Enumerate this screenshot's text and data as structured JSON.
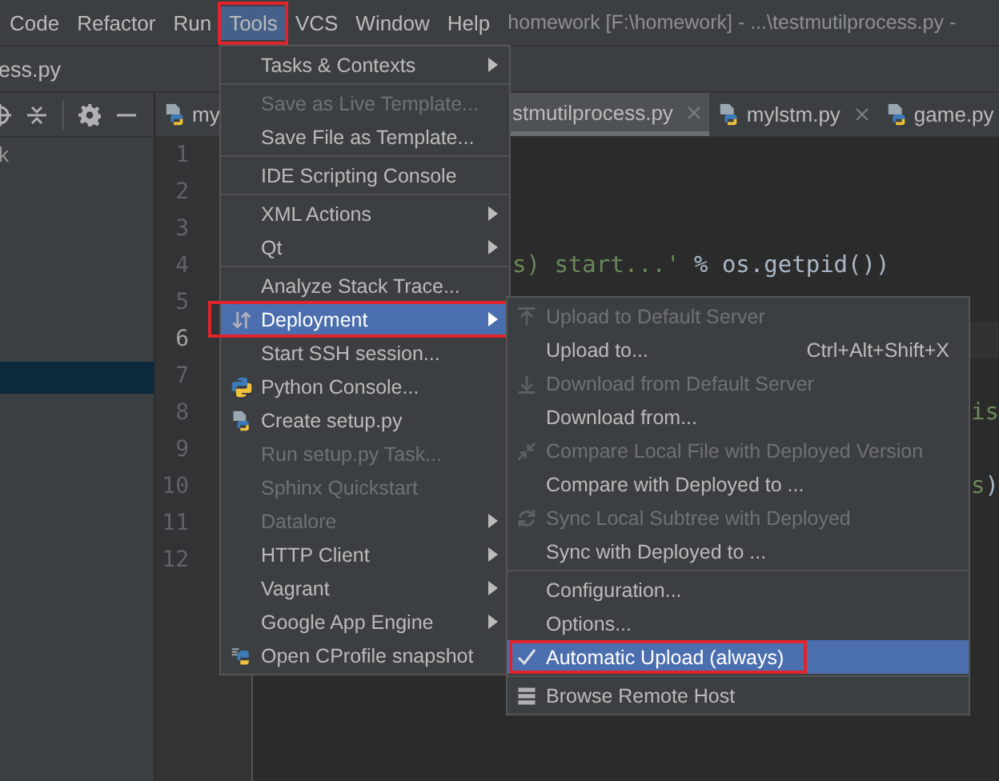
{
  "menu_bar": {
    "items": [
      {
        "label": "Code",
        "selected": false,
        "marked": false
      },
      {
        "label": "Refactor",
        "selected": false,
        "marked": false
      },
      {
        "label": "Run",
        "selected": false,
        "marked": false
      },
      {
        "label": "Tools",
        "selected": true,
        "marked": true
      },
      {
        "label": "VCS",
        "selected": false,
        "marked": false
      },
      {
        "label": "Window",
        "selected": false,
        "marked": false
      },
      {
        "label": "Help",
        "selected": false,
        "marked": false
      }
    ],
    "title": "homework [F:\\homework] - ...\\testmutilprocess.py -"
  },
  "navigation_bar": {
    "path": "ess.py"
  },
  "project_panel": {
    "rows": [
      {
        "label": "k",
        "selected": false
      },
      {
        "selected": false
      },
      {
        "selected": false
      },
      {
        "selected": false
      },
      {
        "selected": false
      },
      {
        "selected": false
      },
      {
        "selected": false
      },
      {
        "selected": true
      }
    ]
  },
  "editor": {
    "tabs": [
      {
        "label": "my",
        "selected": false
      },
      {
        "label": "stmutilprocess.py",
        "selected": true,
        "closable": true
      },
      {
        "label": "mylstm.py",
        "selected": false,
        "closable": true
      },
      {
        "label": "game.py",
        "selected": false
      }
    ],
    "lines": [
      {
        "number": "1",
        "current": false
      },
      {
        "number": "2",
        "current": false
      },
      {
        "number": "3",
        "current": false
      },
      {
        "number": "4",
        "current": false,
        "kind": "middle",
        "segments": [
          {
            "kind": "string",
            "text": "s) start...'"
          },
          {
            "kind": "plain",
            "text": " % os.getpid())"
          }
        ]
      },
      {
        "number": "5",
        "current": false
      },
      {
        "number": "6",
        "current": true
      },
      {
        "number": "7",
        "current": false
      },
      {
        "number": "8",
        "current": false,
        "kind": "tail",
        "segments": [
          {
            "kind": "string",
            "text": "is"
          }
        ]
      },
      {
        "number": "9",
        "current": false
      },
      {
        "number": "10",
        "current": false,
        "kind": "tail",
        "segments": [
          {
            "kind": "string",
            "text": "s"
          },
          {
            "kind": "plain",
            "text": ")"
          }
        ]
      },
      {
        "number": "11",
        "current": false
      },
      {
        "number": "12",
        "current": false
      }
    ]
  },
  "tools_menu": {
    "items": [
      {
        "kind": "item",
        "label": "Tasks & Contexts",
        "disabled": false,
        "submenu": true,
        "selected": false,
        "marked": false
      },
      {
        "kind": "separator"
      },
      {
        "kind": "item",
        "label": "Save as Live Template...",
        "disabled": true,
        "submenu": false,
        "selected": false,
        "marked": false
      },
      {
        "kind": "item",
        "label": "Save File as Template...",
        "disabled": false,
        "submenu": false,
        "selected": false,
        "marked": false
      },
      {
        "kind": "separator"
      },
      {
        "kind": "item",
        "label": "IDE Scripting Console",
        "disabled": false,
        "submenu": false,
        "selected": false,
        "marked": false
      },
      {
        "kind": "separator"
      },
      {
        "kind": "item",
        "label": "XML Actions",
        "disabled": false,
        "submenu": true,
        "selected": false,
        "marked": false
      },
      {
        "kind": "item",
        "label": "Qt",
        "disabled": false,
        "submenu": true,
        "selected": false,
        "marked": false
      },
      {
        "kind": "separator"
      },
      {
        "kind": "item",
        "label": "Analyze Stack Trace...",
        "disabled": false,
        "submenu": false,
        "selected": false,
        "marked": false
      },
      {
        "kind": "item",
        "label": "Deployment",
        "disabled": false,
        "submenu": true,
        "selected": true,
        "marked": true
      },
      {
        "kind": "item",
        "label": "Start SSH session...",
        "disabled": false,
        "submenu": false,
        "selected": false,
        "marked": false
      },
      {
        "kind": "item",
        "label": "Python Console...",
        "disabled": false,
        "submenu": false,
        "selected": false,
        "marked": false
      },
      {
        "kind": "item",
        "label": "Create setup.py",
        "disabled": false,
        "submenu": false,
        "selected": false,
        "marked": false
      },
      {
        "kind": "item",
        "label": "Run setup.py Task...",
        "disabled": true,
        "submenu": false,
        "selected": false,
        "marked": false
      },
      {
        "kind": "item",
        "label": "Sphinx Quickstart",
        "disabled": true,
        "submenu": false,
        "selected": false,
        "marked": false
      },
      {
        "kind": "item",
        "label": "Datalore",
        "disabled": true,
        "submenu": true,
        "selected": false,
        "marked": false
      },
      {
        "kind": "item",
        "label": "HTTP Client",
        "disabled": false,
        "submenu": true,
        "selected": false,
        "marked": false
      },
      {
        "kind": "item",
        "label": "Vagrant",
        "disabled": false,
        "submenu": true,
        "selected": false,
        "marked": false
      },
      {
        "kind": "item",
        "label": "Google App Engine",
        "disabled": false,
        "submenu": true,
        "selected": false,
        "marked": false
      },
      {
        "kind": "item",
        "label": "Open CProfile snapshot",
        "disabled": false,
        "submenu": false,
        "selected": false,
        "marked": false
      }
    ]
  },
  "deployment_submenu": {
    "items": [
      {
        "kind": "item",
        "label": "Upload to Default Server",
        "disabled": true,
        "checked": false,
        "selected": false,
        "marked": false
      },
      {
        "kind": "item",
        "label": "Upload to...",
        "shortcut": "Ctrl+Alt+Shift+X",
        "disabled": false,
        "checked": false,
        "selected": false,
        "marked": false
      },
      {
        "kind": "item",
        "label": "Download from Default Server",
        "disabled": true,
        "checked": false,
        "selected": false,
        "marked": false
      },
      {
        "kind": "item",
        "label": "Download from...",
        "disabled": false,
        "checked": false,
        "selected": false,
        "marked": false
      },
      {
        "kind": "item",
        "label": "Compare Local File with Deployed Version",
        "disabled": true,
        "checked": false,
        "selected": false,
        "marked": false
      },
      {
        "kind": "item",
        "label": "Compare with Deployed to ...",
        "disabled": false,
        "checked": false,
        "selected": false,
        "marked": false
      },
      {
        "kind": "item",
        "label": "Sync Local Subtree with Deployed",
        "disabled": true,
        "checked": false,
        "selected": false,
        "marked": false
      },
      {
        "kind": "item",
        "label": "Sync with Deployed to ...",
        "disabled": false,
        "checked": false,
        "selected": false,
        "marked": false
      },
      {
        "kind": "separator"
      },
      {
        "kind": "item",
        "label": "Configuration...",
        "disabled": false,
        "checked": false,
        "selected": false,
        "marked": false
      },
      {
        "kind": "item",
        "label": "Options...",
        "disabled": false,
        "checked": false,
        "selected": false,
        "marked": false
      },
      {
        "kind": "item",
        "label": "Automatic Upload (always)",
        "disabled": false,
        "checked": true,
        "selected": true,
        "marked": true
      },
      {
        "kind": "separator"
      },
      {
        "kind": "item",
        "label": "Browse Remote Host",
        "disabled": false,
        "checked": false,
        "selected": false,
        "marked": false
      }
    ]
  }
}
